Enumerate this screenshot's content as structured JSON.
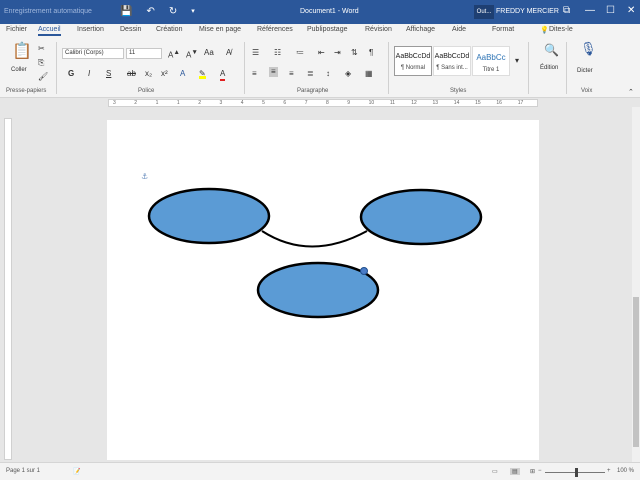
{
  "titlebar": {
    "autosave_label": "Enregistrement automatique",
    "doc_title": "Document1 - Word",
    "outlook_label": "Out...",
    "user_name": "FREDDY MERCIER",
    "icons": [
      "save-icon",
      "undo-icon",
      "redo-icon",
      "customize-icon",
      "ribbon-display-icon",
      "minimize-icon",
      "maximize-icon",
      "close-icon"
    ]
  },
  "tabs": [
    {
      "label": "Fichier"
    },
    {
      "label": "Accueil",
      "active": true
    },
    {
      "label": "Insertion"
    },
    {
      "label": "Dessin"
    },
    {
      "label": "Création"
    },
    {
      "label": "Mise en page"
    },
    {
      "label": "Références"
    },
    {
      "label": "Publipostage"
    },
    {
      "label": "Révision"
    },
    {
      "label": "Affichage"
    },
    {
      "label": "Aide"
    },
    {
      "label": "Format"
    },
    {
      "label": "Dites-le"
    }
  ],
  "ribbon": {
    "clipboard": {
      "paste_label": "Coller",
      "group_label": "Presse-papiers"
    },
    "font": {
      "name": "Calibri (Corps)",
      "size": "11",
      "group_label": "Police",
      "buttons": [
        "G",
        "I",
        "S",
        "ab",
        "x₂",
        "x²",
        "A",
        "A"
      ]
    },
    "paragraph": {
      "group_label": "Paragraphe"
    },
    "styles": {
      "group_label": "Styles",
      "items": [
        {
          "preview": "AaBbCcDd",
          "name": "¶ Normal"
        },
        {
          "preview": "AaBbCcDd",
          "name": "¶ Sans int..."
        },
        {
          "preview": "AaBbCc",
          "name": "Titre 1"
        }
      ]
    },
    "editing": {
      "label": "Édition"
    },
    "voice": {
      "label": "Dicter",
      "group_label": "Voix"
    }
  },
  "ruler": {
    "marks": [
      "3",
      "2",
      "1",
      "1",
      "2",
      "3",
      "4",
      "5",
      "6",
      "7",
      "8",
      "9",
      "10",
      "11",
      "12",
      "13",
      "14",
      "15",
      "16",
      "17"
    ]
  },
  "status": {
    "page_info": "Page 1 sur 1",
    "zoom": "100 %"
  },
  "colors": {
    "accent": "#2b579a",
    "shape_fill": "#5b9bd5",
    "shape_stroke": "#000000"
  }
}
